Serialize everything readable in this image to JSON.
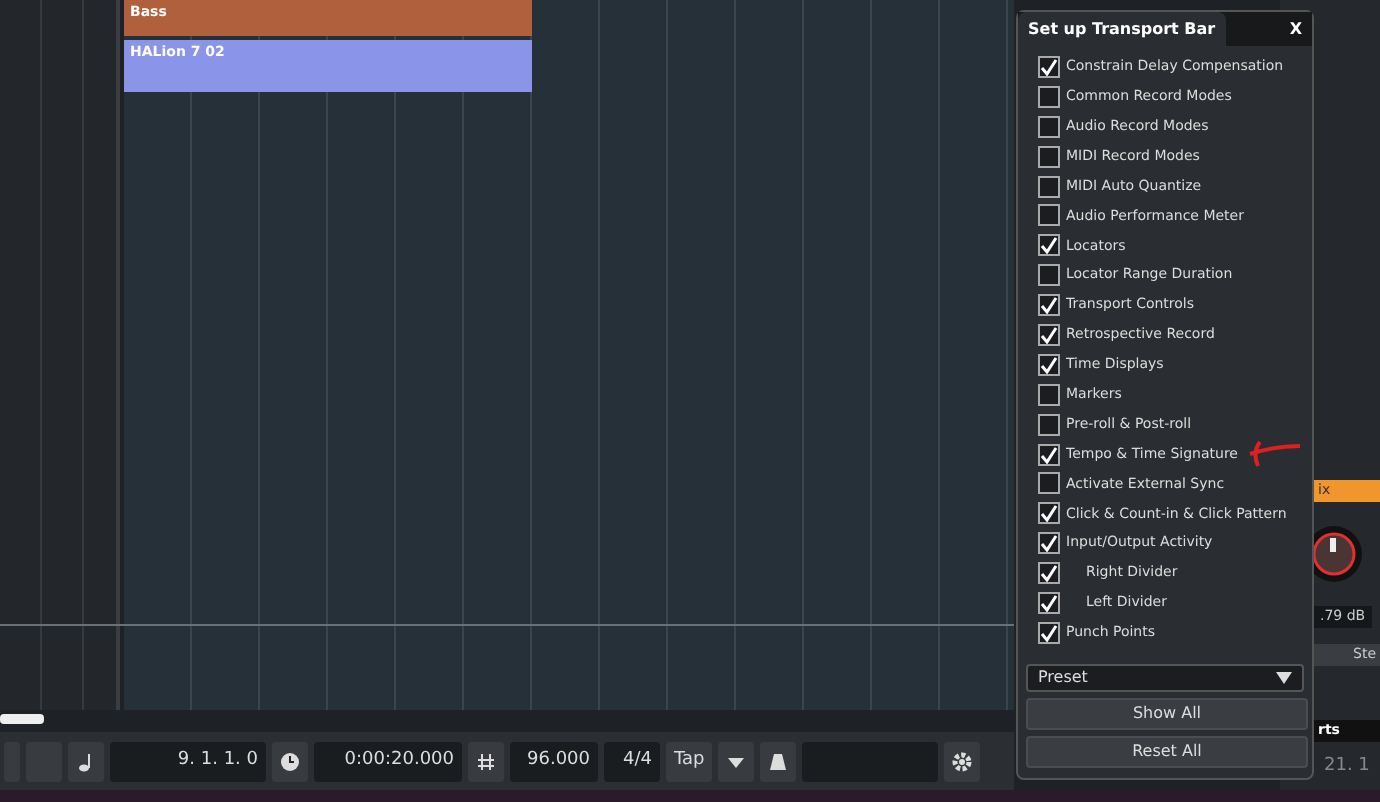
{
  "parts": [
    {
      "name": "Bass",
      "color": "#b0603c"
    },
    {
      "name": "HALion 7 02",
      "color": "#8a94e8"
    }
  ],
  "dialog": {
    "title": "Set up Transport Bar",
    "close": "X",
    "items": [
      {
        "label": "Constrain Delay Compensation",
        "checked": true,
        "kind": "section"
      },
      {
        "label": "Common Record Modes",
        "checked": false,
        "kind": "section"
      },
      {
        "label": "Audio Record Modes",
        "checked": false,
        "kind": "section"
      },
      {
        "label": "MIDI Record Modes",
        "checked": false,
        "kind": "section"
      },
      {
        "label": "MIDI Auto Quantize",
        "checked": false,
        "kind": "section"
      },
      {
        "label": "Audio Performance Meter",
        "checked": false,
        "kind": "section"
      },
      {
        "label": "Locators",
        "checked": true,
        "kind": "section"
      },
      {
        "label": "Locator Range Duration",
        "checked": false,
        "kind": "section"
      },
      {
        "label": "Transport Controls",
        "checked": true,
        "kind": "section"
      },
      {
        "label": "Retrospective Record",
        "checked": true,
        "kind": "section"
      },
      {
        "label": "Time Displays",
        "checked": true,
        "kind": "section"
      },
      {
        "label": "Markers",
        "checked": false,
        "kind": "section"
      },
      {
        "label": "Pre-roll & Post-roll",
        "checked": false,
        "kind": "section"
      },
      {
        "label": "Tempo & Time Signature",
        "checked": true,
        "kind": "section",
        "annotated": true
      },
      {
        "label": "Activate External Sync",
        "checked": false,
        "kind": "section"
      },
      {
        "label": "Click & Count-in & Click Pattern",
        "checked": true,
        "kind": "section"
      },
      {
        "label": "Input/Output Activity",
        "checked": true,
        "kind": "section"
      },
      {
        "label": "Right Divider",
        "checked": true,
        "kind": "divider"
      },
      {
        "label": "Left Divider",
        "checked": true,
        "kind": "divider"
      },
      {
        "label": "Punch Points",
        "checked": true,
        "kind": "section"
      }
    ],
    "preset": "Preset",
    "buttons": [
      "Show All",
      "Reset All"
    ]
  },
  "transport": {
    "position": "9. 1. 1. 0",
    "time": "0:00:20.000",
    "tempo": "96.000",
    "signature": "4/4",
    "tap": "Tap"
  },
  "right_panel": {
    "mix_tab": "ix",
    "gain": ".79 dB",
    "button": "Ste",
    "section": "rts",
    "display": "21. 1"
  }
}
